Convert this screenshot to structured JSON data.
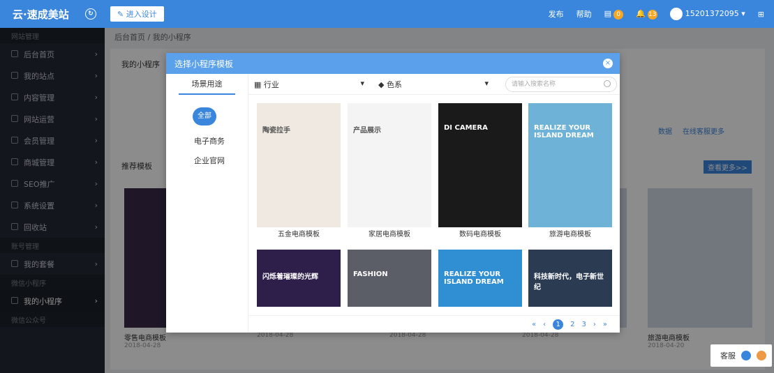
{
  "app": {
    "logo": "云·速成美站",
    "design_button": "进入设计"
  },
  "topbar": {
    "publish": "发布",
    "help": "帮助",
    "msg_badge": "0",
    "notify_badge": "13",
    "user": "15201372095"
  },
  "sidebar": {
    "items": [
      {
        "label": "网站管理",
        "section": true
      },
      {
        "label": "后台首页"
      },
      {
        "label": "我的站点"
      },
      {
        "label": "内容管理"
      },
      {
        "label": "网站运营"
      },
      {
        "label": "会员管理"
      },
      {
        "label": "商城管理"
      },
      {
        "label": "SEO推广"
      },
      {
        "label": "系统设置"
      },
      {
        "label": "回收站"
      },
      {
        "label": "账号管理",
        "section": true
      },
      {
        "label": "我的套餐"
      },
      {
        "label": "微信小程序",
        "section": true
      },
      {
        "label": "我的小程序"
      },
      {
        "label": "微信公众号",
        "section": true
      }
    ]
  },
  "breadcrumb": {
    "home": "后台首页",
    "current": "我的小程序"
  },
  "background": {
    "my_programs": "我的小程序",
    "recommend": "推荐模板",
    "more": "查看更多>>",
    "data_link": "数据",
    "online_link": "在线客服",
    "more_link": "更多",
    "items": [
      {
        "name": "零售电商模板",
        "date": "2018-04-28"
      },
      {
        "name": "",
        "date": "2018-04-28"
      },
      {
        "name": "",
        "date": "2018-04-28"
      },
      {
        "name": "",
        "date": "2018-04-28"
      },
      {
        "name": "旅游电商模板",
        "date": "2018-04-20"
      }
    ]
  },
  "modal": {
    "title": "选择小程序模板",
    "close": "×",
    "left_header": "场景用途",
    "categories": [
      "全部",
      "电子商务",
      "企业官网"
    ],
    "filter_industry": "行业",
    "filter_color": "色系",
    "search_placeholder": "请输入搜索名称",
    "cards": [
      {
        "name": "五金电商模板",
        "text": "陶瓷拉手",
        "bg": "#efe9e1"
      },
      {
        "name": "家居电商模板",
        "text": "产品展示",
        "bg": "#f4f4f4"
      },
      {
        "name": "数码电商模板",
        "text": "DI CAMERA",
        "bg": "#1a1a1a"
      },
      {
        "name": "旅游电商模板",
        "text": "REALIZE YOUR ISLAND DREAM",
        "bg": "#6fb2d8"
      },
      {
        "name": "",
        "text": "闪烁着璀璨的光辉",
        "bg": "#2d1e4a"
      },
      {
        "name": "",
        "text": "FASHION",
        "bg": "#5b5e66"
      },
      {
        "name": "",
        "text": "REALIZE YOUR ISLAND DREAM",
        "bg": "#2f8fd2"
      },
      {
        "name": "",
        "text": "科技新时代，电子新世纪",
        "bg": "#2b3b52"
      }
    ],
    "pager": {
      "first": "«",
      "prev": "‹",
      "pages": [
        "1",
        "2",
        "3"
      ],
      "next": "›",
      "last": "»"
    }
  },
  "kefu": {
    "label": "客服"
  }
}
